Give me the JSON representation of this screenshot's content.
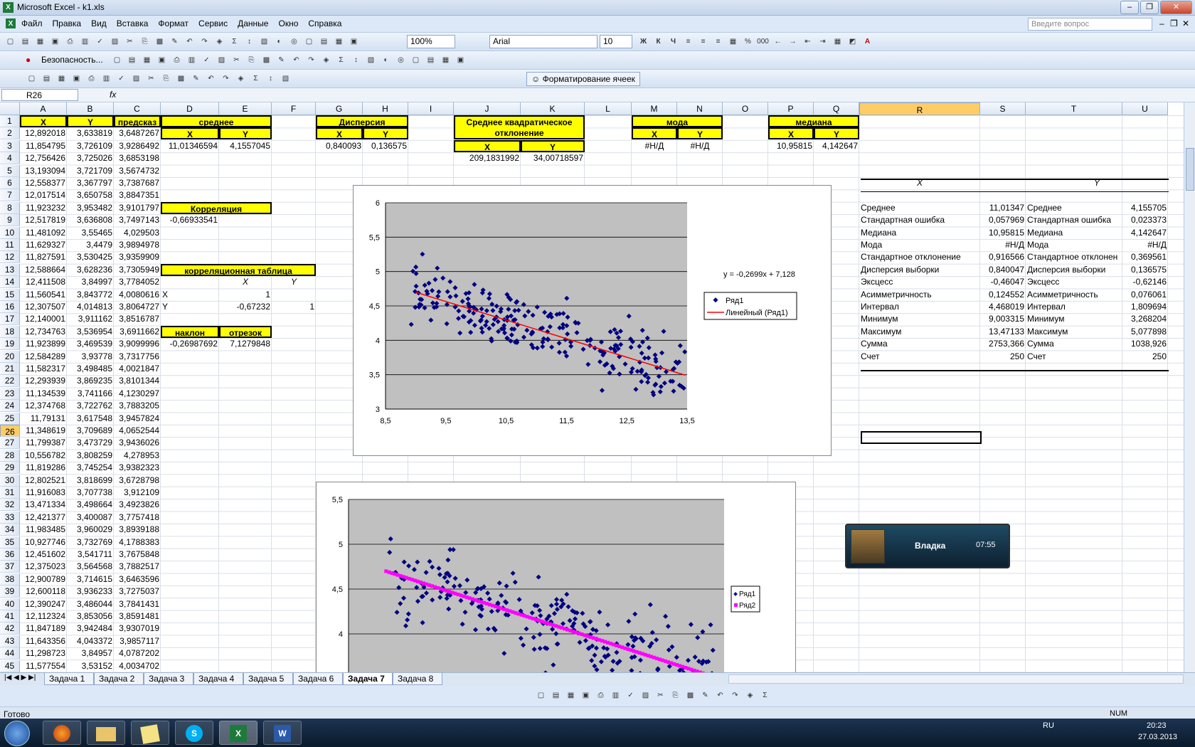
{
  "window": {
    "title": "Microsoft Excel - k1.xls",
    "ask": "Введите вопрос"
  },
  "menu": [
    "Файл",
    "Правка",
    "Вид",
    "Вставка",
    "Формат",
    "Сервис",
    "Данные",
    "Окно",
    "Справка"
  ],
  "toolbar": {
    "zoom": "100%",
    "font": "Arial",
    "size": "10",
    "security": "Безопасность...",
    "format_cells": "Форматирование ячеек"
  },
  "formula": {
    "namebox": "R26",
    "fx": "fx"
  },
  "columns": [
    {
      "n": "A",
      "w": 66
    },
    {
      "n": "B",
      "w": 66
    },
    {
      "n": "C",
      "w": 66
    },
    {
      "n": "D",
      "w": 82
    },
    {
      "n": "E",
      "w": 74
    },
    {
      "n": "F",
      "w": 62
    },
    {
      "n": "G",
      "w": 66
    },
    {
      "n": "H",
      "w": 64
    },
    {
      "n": "I",
      "w": 64
    },
    {
      "n": "J",
      "w": 94
    },
    {
      "n": "K",
      "w": 90
    },
    {
      "n": "L",
      "w": 66
    },
    {
      "n": "M",
      "w": 64
    },
    {
      "n": "N",
      "w": 64
    },
    {
      "n": "O",
      "w": 64
    },
    {
      "n": "P",
      "w": 64
    },
    {
      "n": "Q",
      "w": 64
    },
    {
      "n": "R",
      "w": 170
    },
    {
      "n": "S",
      "w": 64
    },
    {
      "n": "T",
      "w": 136
    },
    {
      "n": "U",
      "w": 64
    }
  ],
  "rows_a": [
    "X",
    "12,892018",
    "11,854795",
    "12,756426",
    "13,193094",
    "12,558377",
    "12,017514",
    "11,923232",
    "12,517819",
    "11,481092",
    "11,629327",
    "11,827591",
    "12,588664",
    "12,411508",
    "11,560541",
    "12,307507",
    "12,140001",
    "12,734763",
    "11,923899",
    "12,584289",
    "11,582317",
    "12,293939",
    "11,134539",
    "12,374768",
    "11,79131",
    "11,348619",
    "11,799387",
    "10,556782",
    "11,819286",
    "12,802521",
    "11,916083",
    "13,471334",
    "12,421377",
    "11,983485",
    "10,927746",
    "12,451602",
    "12,375023",
    "12,900789",
    "12,600118",
    "12,390247",
    "12,112324",
    "11,847189",
    "11,643356",
    "11,298723",
    "11,577554"
  ],
  "rows_b": [
    "Y",
    "3,633819",
    "3,726109",
    "3,725026",
    "3,721709",
    "3,367797",
    "3,650758",
    "3,953482",
    "3,636808",
    "3,55465",
    "3,4479",
    "3,530425",
    "3,628236",
    "3,84997",
    "3,843772",
    "4,014813",
    "3,911162",
    "3,536954",
    "3,469539",
    "3,93778",
    "3,498485",
    "3,869235",
    "3,741166",
    "3,722762",
    "3,617548",
    "3,709689",
    "3,473729",
    "3,808259",
    "3,745254",
    "3,818699",
    "3,707738",
    "3,498664",
    "3,400087",
    "3,960029",
    "3,732769",
    "3,541711",
    "3,564568",
    "3,714615",
    "3,936233",
    "3,486044",
    "3,853056",
    "3,942484",
    "4,043372",
    "3,84957",
    "3,53152"
  ],
  "rows_c": [
    "предсказ",
    "3,6487267",
    "3,9286492",
    "3,6853198",
    "3,5674732",
    "3,7387687",
    "3,8847351",
    "3,9101797",
    "3,7497143",
    "4,029503",
    "3,9894978",
    "3,9359909",
    "3,7305949",
    "3,7784052",
    "4,0080616",
    "3,8064727",
    "3,8516787",
    "3,6911662",
    "3,9099996",
    "3,7317756",
    "4,0021847",
    "3,8101344",
    "4,1230297",
    "3,7883205",
    "3,9457824",
    "4,0652544",
    "3,9436026",
    "4,278953",
    "3,9382323",
    "3,6728798",
    "3,912109",
    "3,4923826",
    "3,7757418",
    "3,8939188",
    "4,1788383",
    "3,7675848",
    "3,7882517",
    "3,6463596",
    "3,7275037",
    "3,7841431",
    "3,8591481",
    "3,9307019",
    "3,9857117",
    "4,0787202",
    "4,0034702"
  ],
  "labels": {
    "mean": "среднее",
    "x": "X",
    "y": "Y",
    "mean_x": "11,01346594",
    "mean_y": "4,1557045",
    "disp": "Дисперсия",
    "disp_x": "0,840093",
    "disp_y": "0,136575",
    "sko1": "Среднее квадратическое",
    "sko2": "отклонение",
    "sko_x": "209,1831992",
    "sko_y": "34,00718597",
    "mode": "мода",
    "mode_x": "#Н/Д",
    "mode_y": "#Н/Д",
    "median": "медиана",
    "median_x": "10,95815",
    "median_y": "4,142647",
    "corr": "Корреляция",
    "corr_v": "-0,66933541",
    "ctable": "корреляционная таблица",
    "ct_X": "X",
    "ct_Y": "Y",
    "ct_1": "1",
    "ct_2": "-0,67232",
    "ct_3": "1",
    "slope": "наклон",
    "intercept": "отрезок",
    "slope_v": "-0,26987692",
    "int_v": "7,1279848"
  },
  "stats": {
    "hx": "X",
    "hy": "Y",
    "rows": [
      [
        "Среднее",
        "11,01347",
        "Среднее",
        "4,155705"
      ],
      [
        "Стандартная ошибка",
        "0,057969",
        "Стандартная ошибка",
        "0,023373"
      ],
      [
        "Медиана",
        "10,95815",
        "Медиана",
        "4,142647"
      ],
      [
        "Мода",
        "#Н/Д",
        "Мода",
        "#Н/Д"
      ],
      [
        "Стандартное отклонение",
        "0,916566",
        "Стандартное отклонен",
        "0,369561"
      ],
      [
        "Дисперсия выборки",
        "0,840047",
        "Дисперсия выборки",
        "0,136575"
      ],
      [
        "Эксцесс",
        "-0,46047",
        "Эксцесс",
        "-0,62146"
      ],
      [
        "Асимметричность",
        "0,124552",
        "Асимметричность",
        "0,076061"
      ],
      [
        "Интервал",
        "4,468019",
        "Интервал",
        "1,809694"
      ],
      [
        "Минимум",
        "9,003315",
        "Минимум",
        "3,268204"
      ],
      [
        "Максимум",
        "13,47133",
        "Максимум",
        "5,077898"
      ],
      [
        "Сумма",
        "2753,366",
        "Сумма",
        "1038,926"
      ],
      [
        "Счет",
        "250",
        "Счет",
        "250"
      ]
    ]
  },
  "chart_data": [
    {
      "type": "scatter",
      "title": "",
      "xlim": [
        8.5,
        13.5
      ],
      "ylim": [
        3,
        6
      ],
      "xticks": [
        "8,5",
        "9,5",
        "10,5",
        "11,5",
        "12,5",
        "13,5"
      ],
      "yticks": [
        "3",
        "3,5",
        "4",
        "4,5",
        "5",
        "5,5",
        "6"
      ],
      "series": [
        {
          "name": "Ряд1",
          "color": "#000080"
        },
        {
          "name": "Линейный (Ряд1)",
          "color": "#ff0000",
          "trend": {
            "slope": -0.2699,
            "intercept": 7.128
          }
        }
      ],
      "equation": "y = -0,2699x + 7,128",
      "grid": true,
      "legend": "right"
    },
    {
      "type": "scatter",
      "title": "",
      "xlim": [
        8.5,
        13.5
      ],
      "ylim": [
        3.5,
        5.5
      ],
      "yticks": [
        "3,5",
        "4",
        "4,5",
        "5",
        "5,5"
      ],
      "series": [
        {
          "name": "Ряд1",
          "color": "#000080"
        },
        {
          "name": "Ряд2",
          "color": "#ff00ff"
        }
      ],
      "grid": true,
      "legend": "right"
    }
  ],
  "sheets": [
    "Задача 1",
    "Задача 2",
    "Задача 3",
    "Задача 4",
    "Задача 5",
    "Задача 6",
    "Задача 7",
    "Задача 8"
  ],
  "active_sheet": "Задача 7",
  "status": {
    "left": "Готово",
    "num": "NUM"
  },
  "notification": {
    "name": "Владка",
    "time": "07:55"
  },
  "tray": {
    "lang": "RU",
    "time": "20:23",
    "date": "27.03.2013"
  }
}
